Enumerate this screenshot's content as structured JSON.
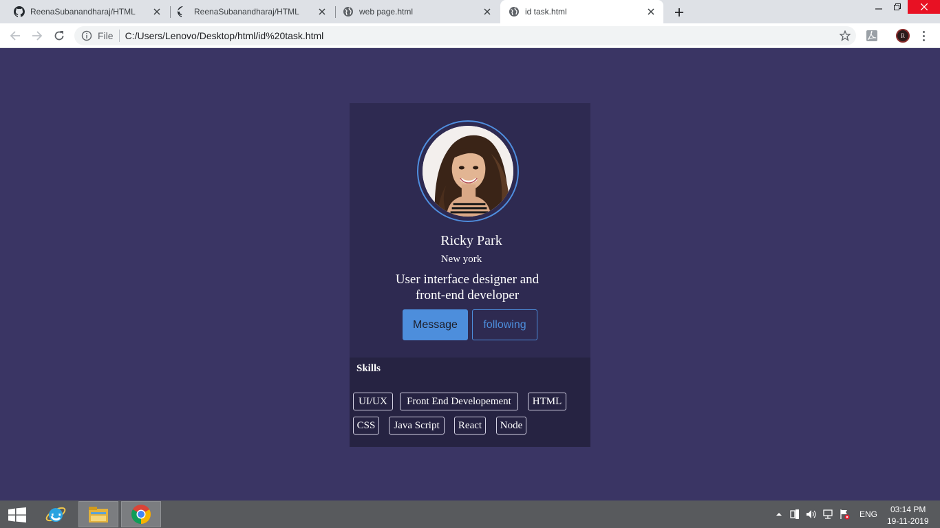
{
  "browser": {
    "tabs": [
      {
        "title": "ReenaSubanandharaj/HTML",
        "icon": "github-icon",
        "active": false
      },
      {
        "title": "ReenaSubanandharaj/HTML",
        "icon": "github-icon",
        "active": false
      },
      {
        "title": "web page.html",
        "icon": "globe-icon",
        "active": false
      },
      {
        "title": "id task.html",
        "icon": "globe-icon",
        "active": true
      }
    ],
    "address": {
      "scheme_label": "File",
      "url": "C:/Users/Lenovo/Desktop/html/id%20task.html"
    },
    "profile_initial": "R"
  },
  "profile": {
    "name": "Ricky Park",
    "city": "New york",
    "bio": "User interface designer and front-end developer",
    "message_label": "Message",
    "following_label": "following"
  },
  "skills": {
    "title": "Skills",
    "items": [
      "UI/UX",
      "Front End Developement",
      "HTML",
      "CSS",
      "Java Script",
      "React",
      "Node"
    ]
  },
  "taskbar": {
    "language": "ENG",
    "time": "03:14 PM",
    "date": "19-11-2019"
  },
  "colors": {
    "page_bg": "#3a3564",
    "card_bg": "#2e2a51",
    "skills_bg": "#262342",
    "accent": "#4d8edc"
  }
}
